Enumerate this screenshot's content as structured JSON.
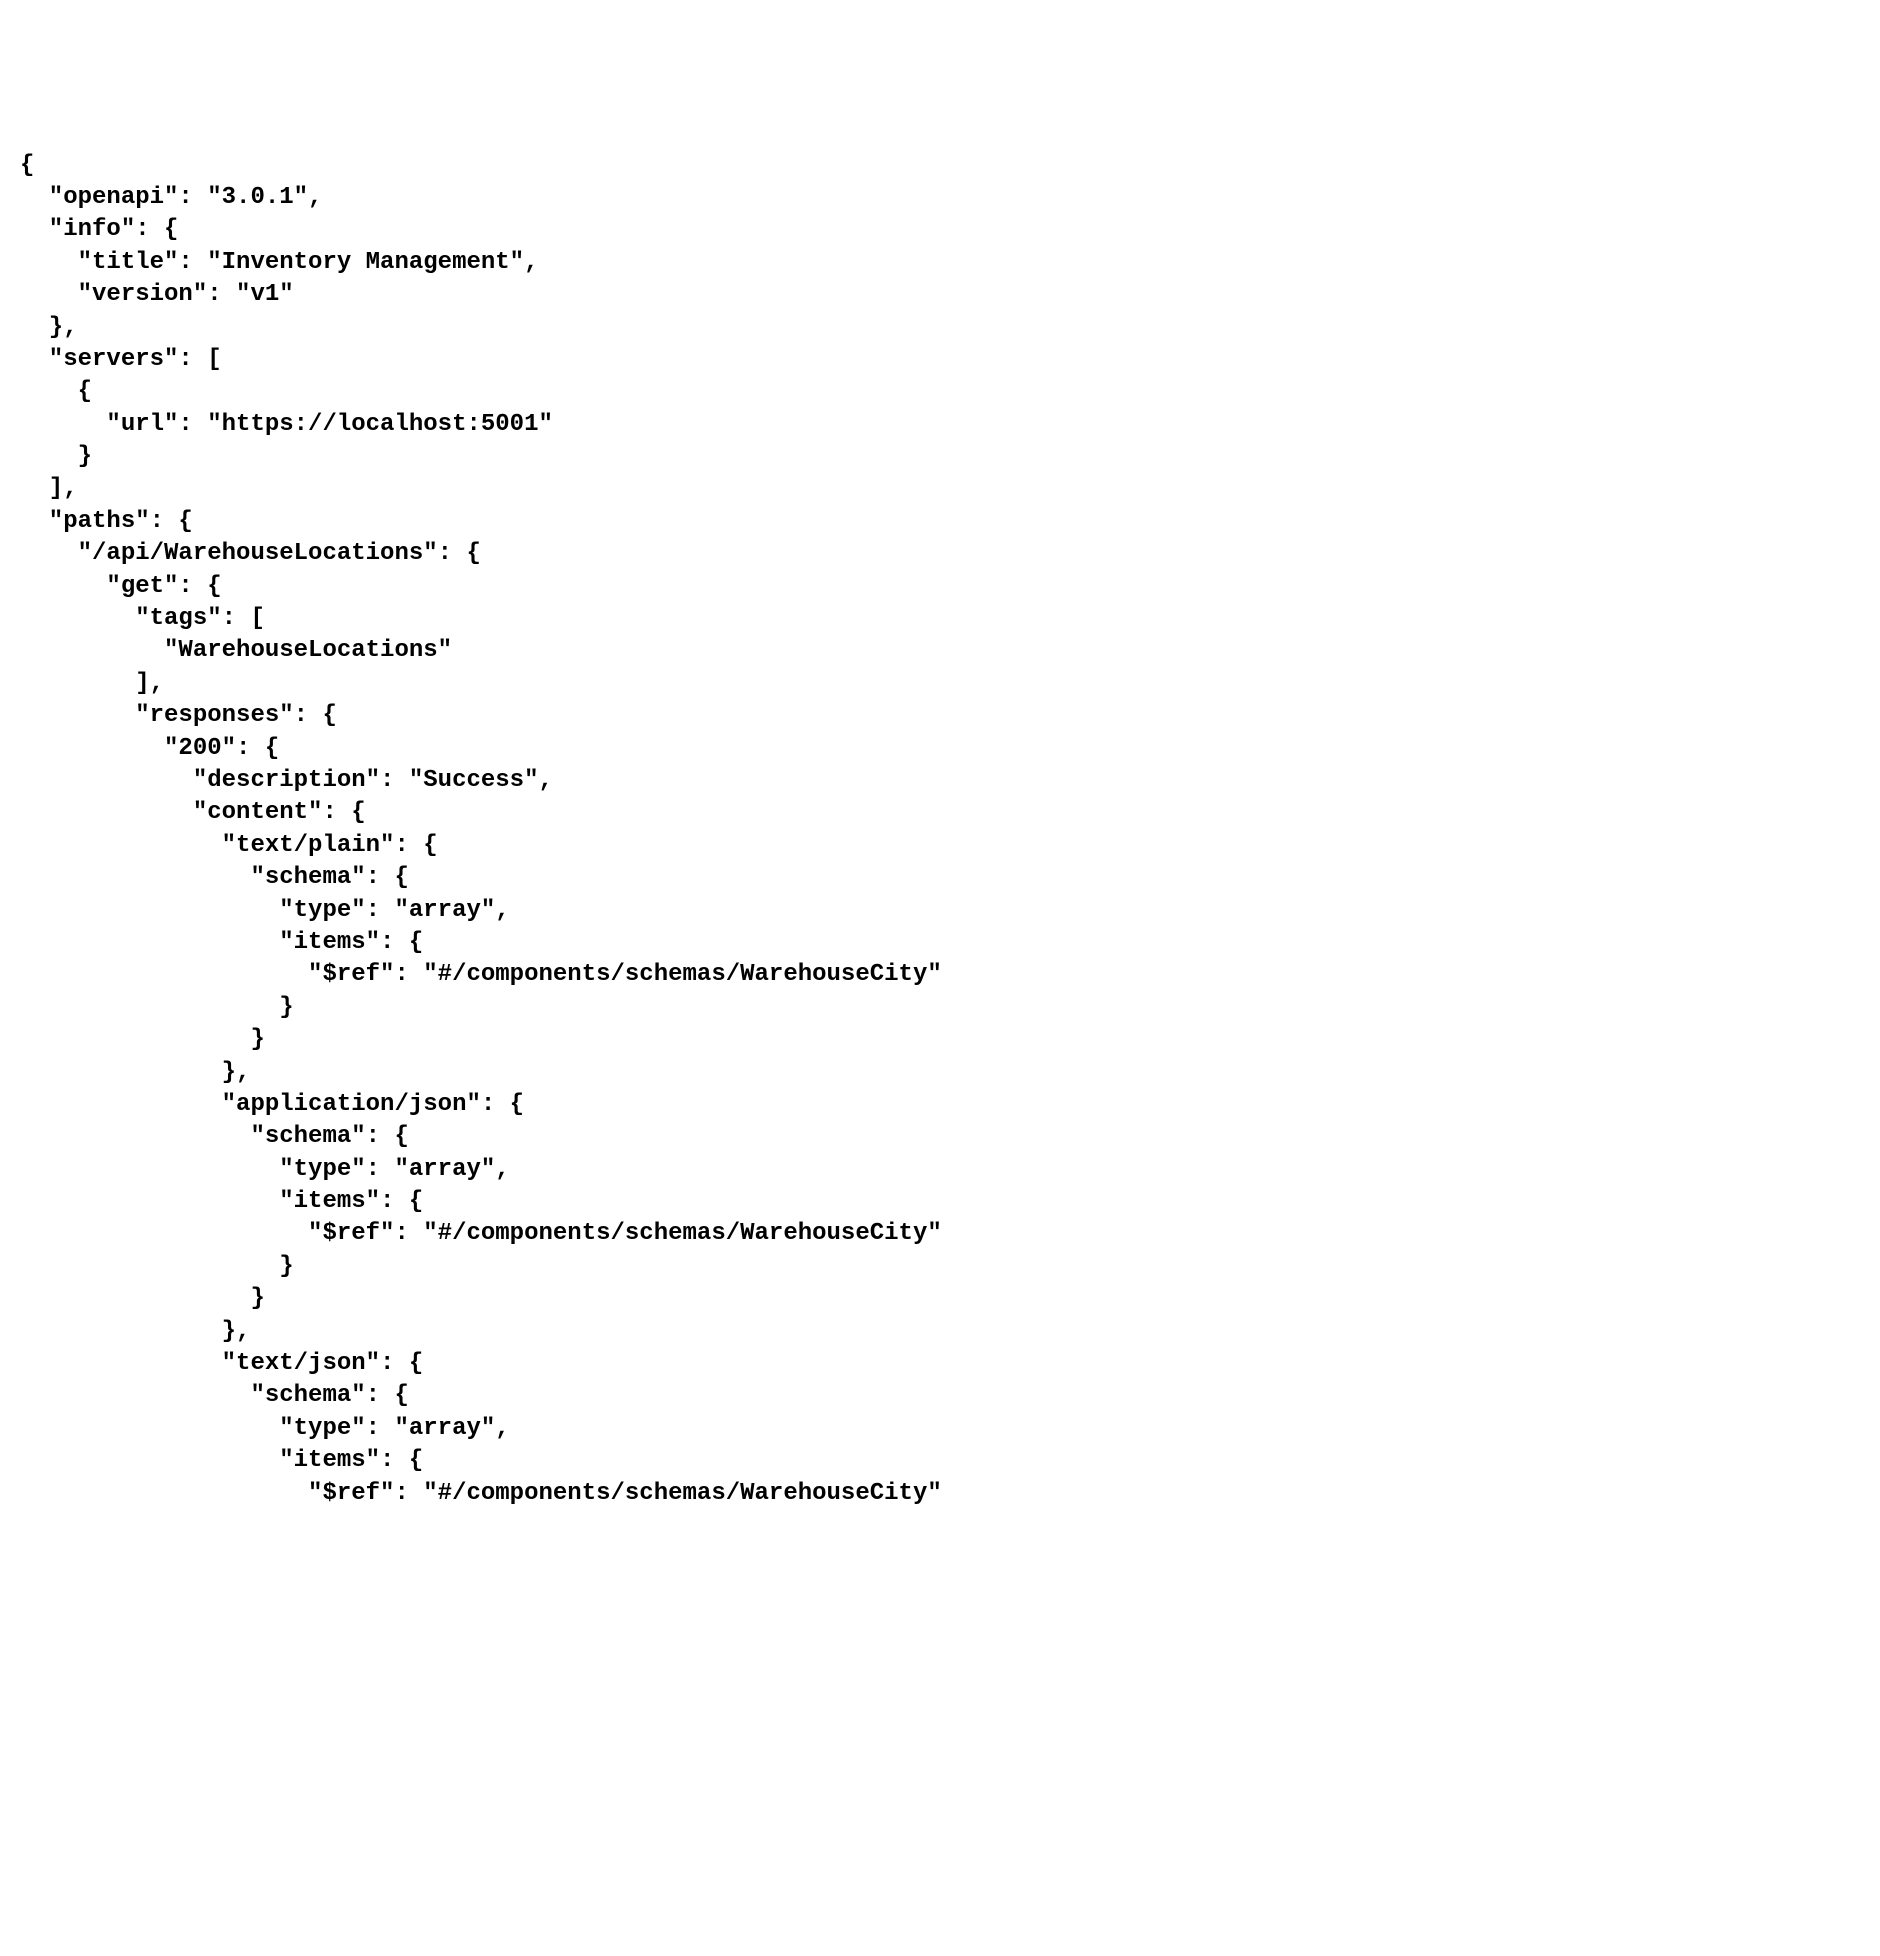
{
  "lines": [
    "{",
    "  \"openapi\": \"3.0.1\",",
    "  \"info\": {",
    "    \"title\": \"Inventory Management\",",
    "    \"version\": \"v1\"",
    "  },",
    "  \"servers\": [",
    "    {",
    "      \"url\": \"https://localhost:5001\"",
    "    }",
    "  ],",
    "  \"paths\": {",
    "    \"/api/WarehouseLocations\": {",
    "      \"get\": {",
    "        \"tags\": [",
    "          \"WarehouseLocations\"",
    "        ],",
    "        \"responses\": {",
    "          \"200\": {",
    "            \"description\": \"Success\",",
    "            \"content\": {",
    "              \"text/plain\": {",
    "                \"schema\": {",
    "                  \"type\": \"array\",",
    "                  \"items\": {",
    "                    \"$ref\": \"#/components/schemas/WarehouseCity\"",
    "                  }",
    "                }",
    "              },",
    "              \"application/json\": {",
    "                \"schema\": {",
    "                  \"type\": \"array\",",
    "                  \"items\": {",
    "                    \"$ref\": \"#/components/schemas/WarehouseCity\"",
    "                  }",
    "                }",
    "              },",
    "              \"text/json\": {",
    "                \"schema\": {",
    "                  \"type\": \"array\",",
    "                  \"items\": {",
    "                    \"$ref\": \"#/components/schemas/WarehouseCity\""
  ]
}
